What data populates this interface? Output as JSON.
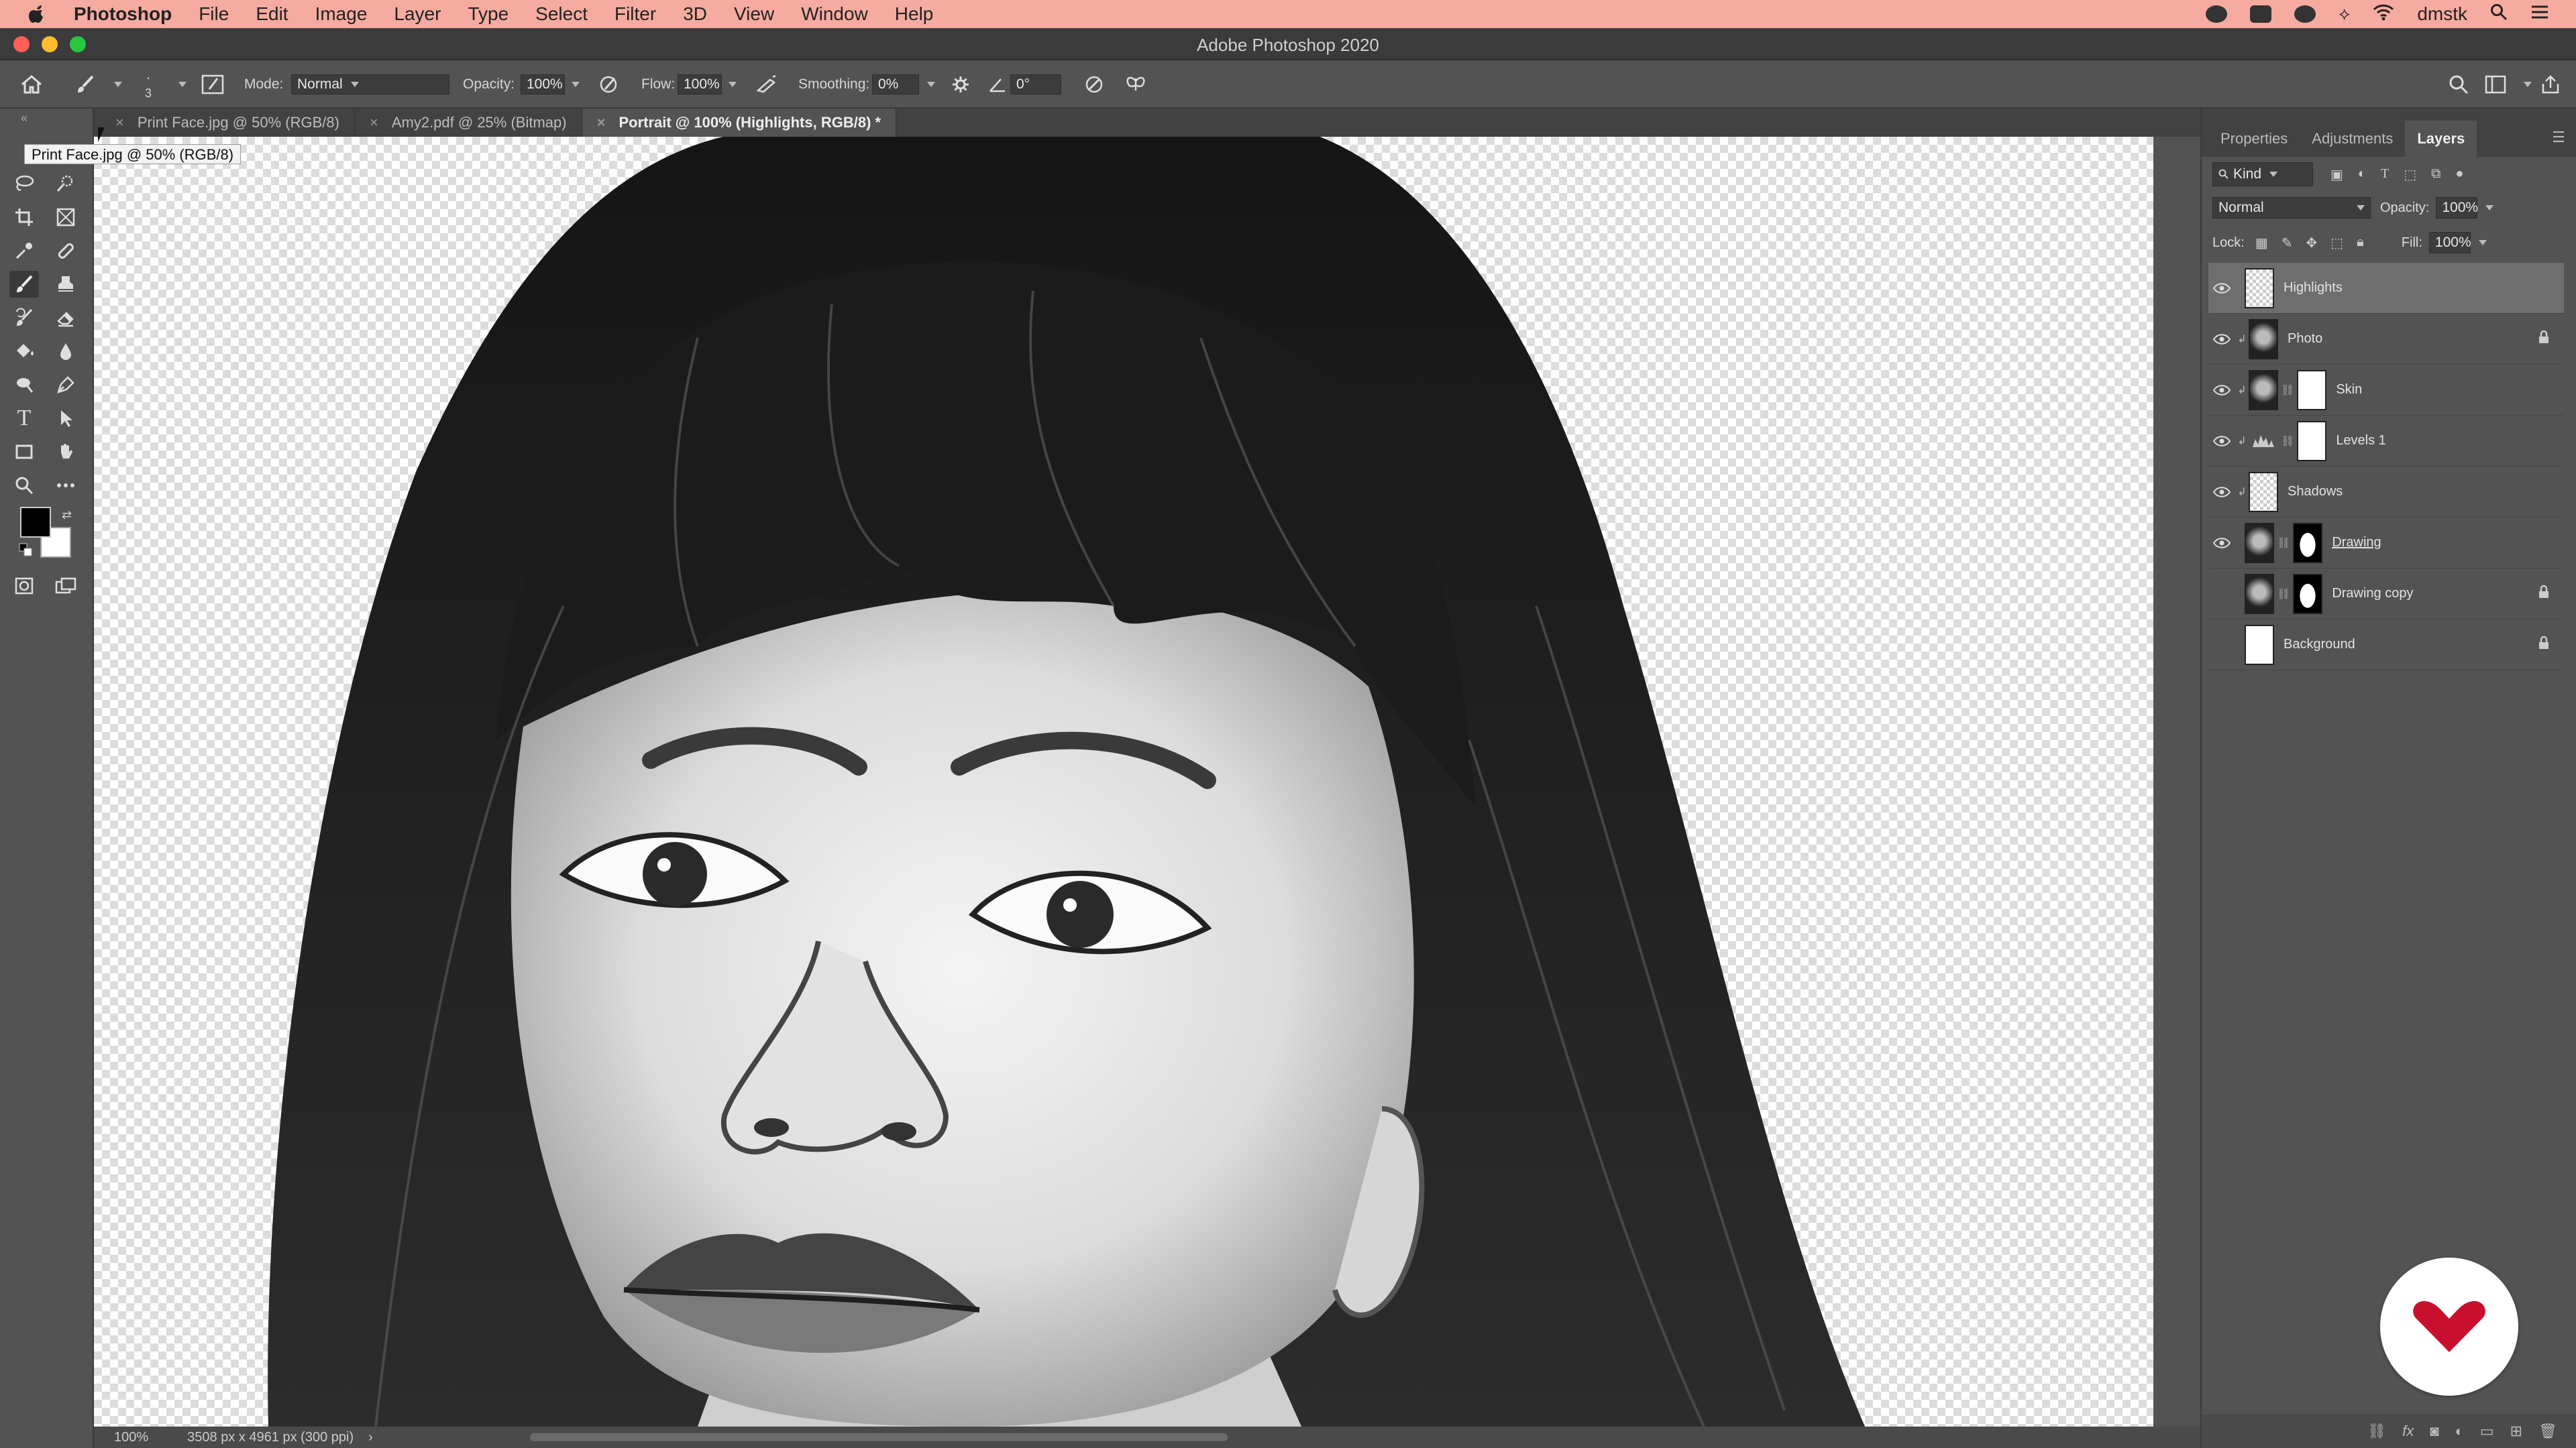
{
  "menubar": {
    "app_name": "Photoshop",
    "items": [
      "File",
      "Edit",
      "Image",
      "Layer",
      "Type",
      "Select",
      "Filter",
      "3D",
      "View",
      "Window",
      "Help"
    ],
    "user": "dmstk"
  },
  "window": {
    "title": "Adobe Photoshop 2020"
  },
  "options": {
    "brush_size": "3",
    "mode_label": "Mode:",
    "mode_value": "Normal",
    "opacity_label": "Opacity:",
    "opacity_value": "100%",
    "flow_label": "Flow:",
    "flow_value": "100%",
    "smoothing_label": "Smoothing:",
    "smoothing_value": "0%",
    "angle_value": "0°"
  },
  "tabs": [
    {
      "label": "Print Face.jpg @ 50% (RGB/8)"
    },
    {
      "label": "Amy2.pdf @ 25% (Bitmap)"
    },
    {
      "label": "Portrait @ 100% (Highlights, RGB/8) *"
    }
  ],
  "tooltip": "Print Face.jpg @ 50% (RGB/8)",
  "status": {
    "zoom": "100%",
    "doc_size": "3508 px x 4961 px (300 ppi)",
    "arrow": "›"
  },
  "panel": {
    "tabs": [
      "Properties",
      "Adjustments",
      "Layers"
    ],
    "active_tab": "Layers",
    "filter_label": "Kind",
    "blend_mode": "Normal",
    "opacity_label": "Opacity:",
    "opacity_value": "100%",
    "lock_label": "Lock:",
    "fill_label": "Fill:",
    "fill_value": "100%",
    "layers": [
      {
        "name": "Highlights",
        "visible": true,
        "selected": true,
        "locked": false
      },
      {
        "name": "Photo",
        "visible": true,
        "locked": true
      },
      {
        "name": "Skin",
        "visible": true,
        "locked": false
      },
      {
        "name": "Levels 1",
        "visible": true,
        "locked": false
      },
      {
        "name": "Shadows",
        "visible": true,
        "locked": false
      },
      {
        "name": "Drawing",
        "visible": true,
        "locked": false
      },
      {
        "name": "Drawing copy",
        "visible": false,
        "locked": true
      },
      {
        "name": "Background",
        "visible": false,
        "locked": true
      }
    ]
  },
  "colors": {
    "menubar_bg": "#f6aba0",
    "ui_bg": "#535353",
    "logo_red": "#c8102e"
  }
}
